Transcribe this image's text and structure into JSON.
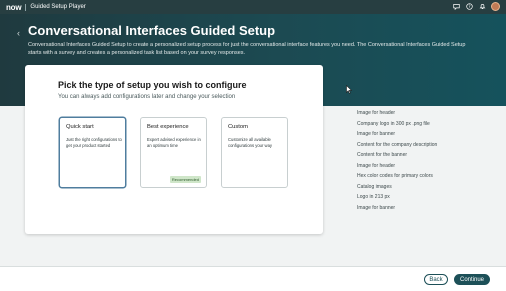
{
  "header": {
    "logo": "now",
    "app_title": "Guided Setup Player",
    "icons": [
      "chat-icon",
      "help-icon",
      "bell-icon",
      "avatar"
    ]
  },
  "hero": {
    "title": "Conversational Interfaces Guided Setup",
    "description": "Conversational Interfaces Guided Setup to create a personalized setup process for just the conversational interface features you need. The Conversational Interfaces Guided Setup starts with a survey and creates a personalized task list based on your survey responses."
  },
  "main": {
    "title": "Pick the type of setup you wish to configure",
    "subtitle": "You can always add configurations later and change your selection",
    "options": [
      {
        "title": "Quick start",
        "description": "Just the right configurations to get your product started",
        "selected": true
      },
      {
        "title": "Best experience",
        "description": "Expert advised experience in an optimum time",
        "badge": "Recommended"
      },
      {
        "title": "Custom",
        "description": "Customize all available configurations your way"
      }
    ]
  },
  "resources": [
    "Image for header",
    "Company logo in 300 px .png file",
    "Image for banner",
    "Content for the company description",
    "Content for the banner",
    "Image for header",
    "Hex color codes for primary colors",
    "Catalog images",
    "Logo in 213 px",
    "Image for banner"
  ],
  "footer": {
    "back_label": "Back",
    "continue_label": "Continue"
  },
  "colors": {
    "topbar": "#273e41",
    "hero": "#1c4a52",
    "primary_button": "#1d5058",
    "badge_bg": "#cfe6c9"
  }
}
